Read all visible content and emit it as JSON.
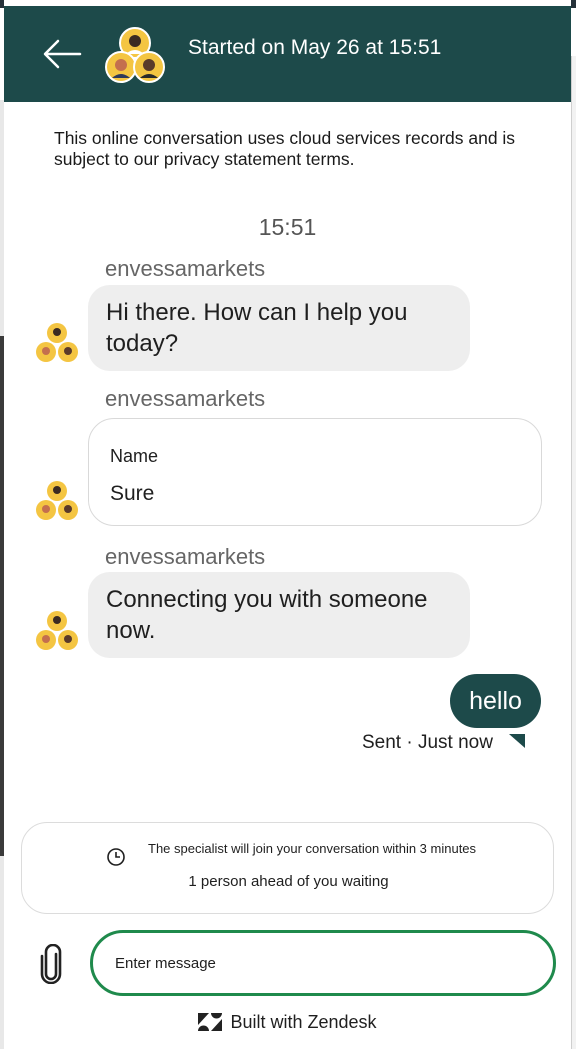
{
  "header": {
    "title": "Started on May 26 at 15:51",
    "accent": "#1d4a4a"
  },
  "privacy_notice": "This online conversation uses cloud services records and is subject to our privacy statement terms.",
  "conversation": {
    "timestamp": "15:51",
    "messages": [
      {
        "sender": "envessamarkets",
        "text": "Hi there. How can I help you today?"
      },
      {
        "sender": "envessamarkets",
        "field_label": "Name",
        "field_value": "Sure"
      },
      {
        "sender": "envessamarkets",
        "text": "Connecting you with someone now."
      }
    ],
    "user_message": {
      "text": "hello",
      "status": "Sent · Just now"
    }
  },
  "queue": {
    "line1": "The specialist will join your conversation within 3 minutes",
    "line2": "1 person ahead of you waiting"
  },
  "composer": {
    "placeholder": "Enter message",
    "border_color": "#1f8a4c"
  },
  "footer": {
    "text": "Built with Zendesk"
  },
  "icons": {
    "back": "back-arrow-icon",
    "attach": "paperclip-icon",
    "clock": "clock-icon",
    "logo": "zendesk-logo-icon"
  }
}
